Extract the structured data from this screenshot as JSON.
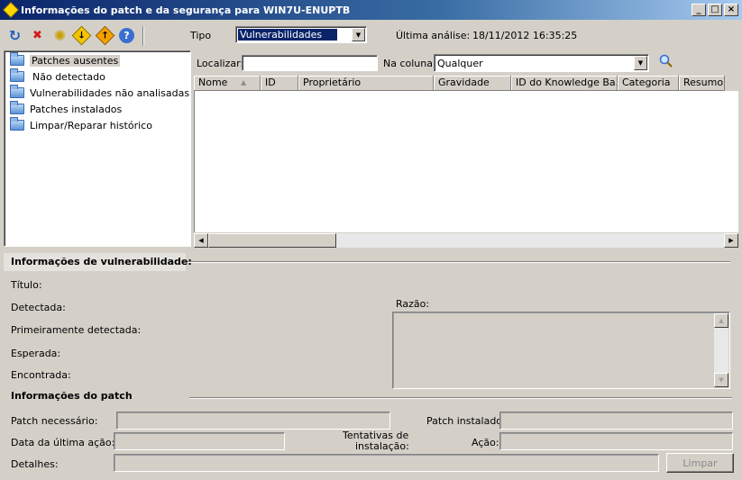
{
  "window": {
    "title": "Informações do patch e da segurança para WIN7U-ENUPTB",
    "min_glyph": "_",
    "max_glyph": "□",
    "close_glyph": "×"
  },
  "toolbar": {
    "refresh_glyph": "↻",
    "delete_glyph": "✖",
    "scan_glyph": "✺",
    "download_glyph": "↓",
    "upload_glyph": "↑",
    "help_glyph": "?",
    "type_label": "Tipo",
    "type_value": "Vulnerabilidades",
    "last_scan_label": "Última análise:",
    "last_scan_value": "18/11/2012 16:35:25"
  },
  "tree": {
    "items": [
      {
        "label": "Patches ausentes"
      },
      {
        "label": "Não detectado"
      },
      {
        "label": "Vulnerabilidades não analisadas"
      },
      {
        "label": "Patches instalados"
      },
      {
        "label": "Limpar/Reparar histórico"
      }
    ]
  },
  "search": {
    "find_label": "Localizar:",
    "find_value": "",
    "column_label": "Na coluna:",
    "column_value": "Qualquer"
  },
  "grid": {
    "columns": [
      {
        "label": "Nome"
      },
      {
        "label": "ID"
      },
      {
        "label": "Proprietário"
      },
      {
        "label": "Gravidade"
      },
      {
        "label": "ID do Knowledge Ba..."
      },
      {
        "label": "Categoria"
      },
      {
        "label": "Resumo"
      }
    ]
  },
  "vuln": {
    "section_title": "Informações de vulnerabilidade:",
    "title_label": "Título:",
    "detected_label": "Detectada:",
    "first_detected_label": "Primeiramente detectada:",
    "expected_label": "Esperada:",
    "found_label": "Encontrada:",
    "reason_label": "Razão:"
  },
  "patch": {
    "section_title": "Informações do patch",
    "required_label": "Patch necessário:",
    "installed_label": "Patch instalado:",
    "last_action_label": "Data da última ação:",
    "attempts_label_1": "Tentativas de",
    "attempts_label_2": "instalação:",
    "action_label": "Ação:",
    "details_label": "Detalhes:",
    "clear_button": "Limpar"
  }
}
